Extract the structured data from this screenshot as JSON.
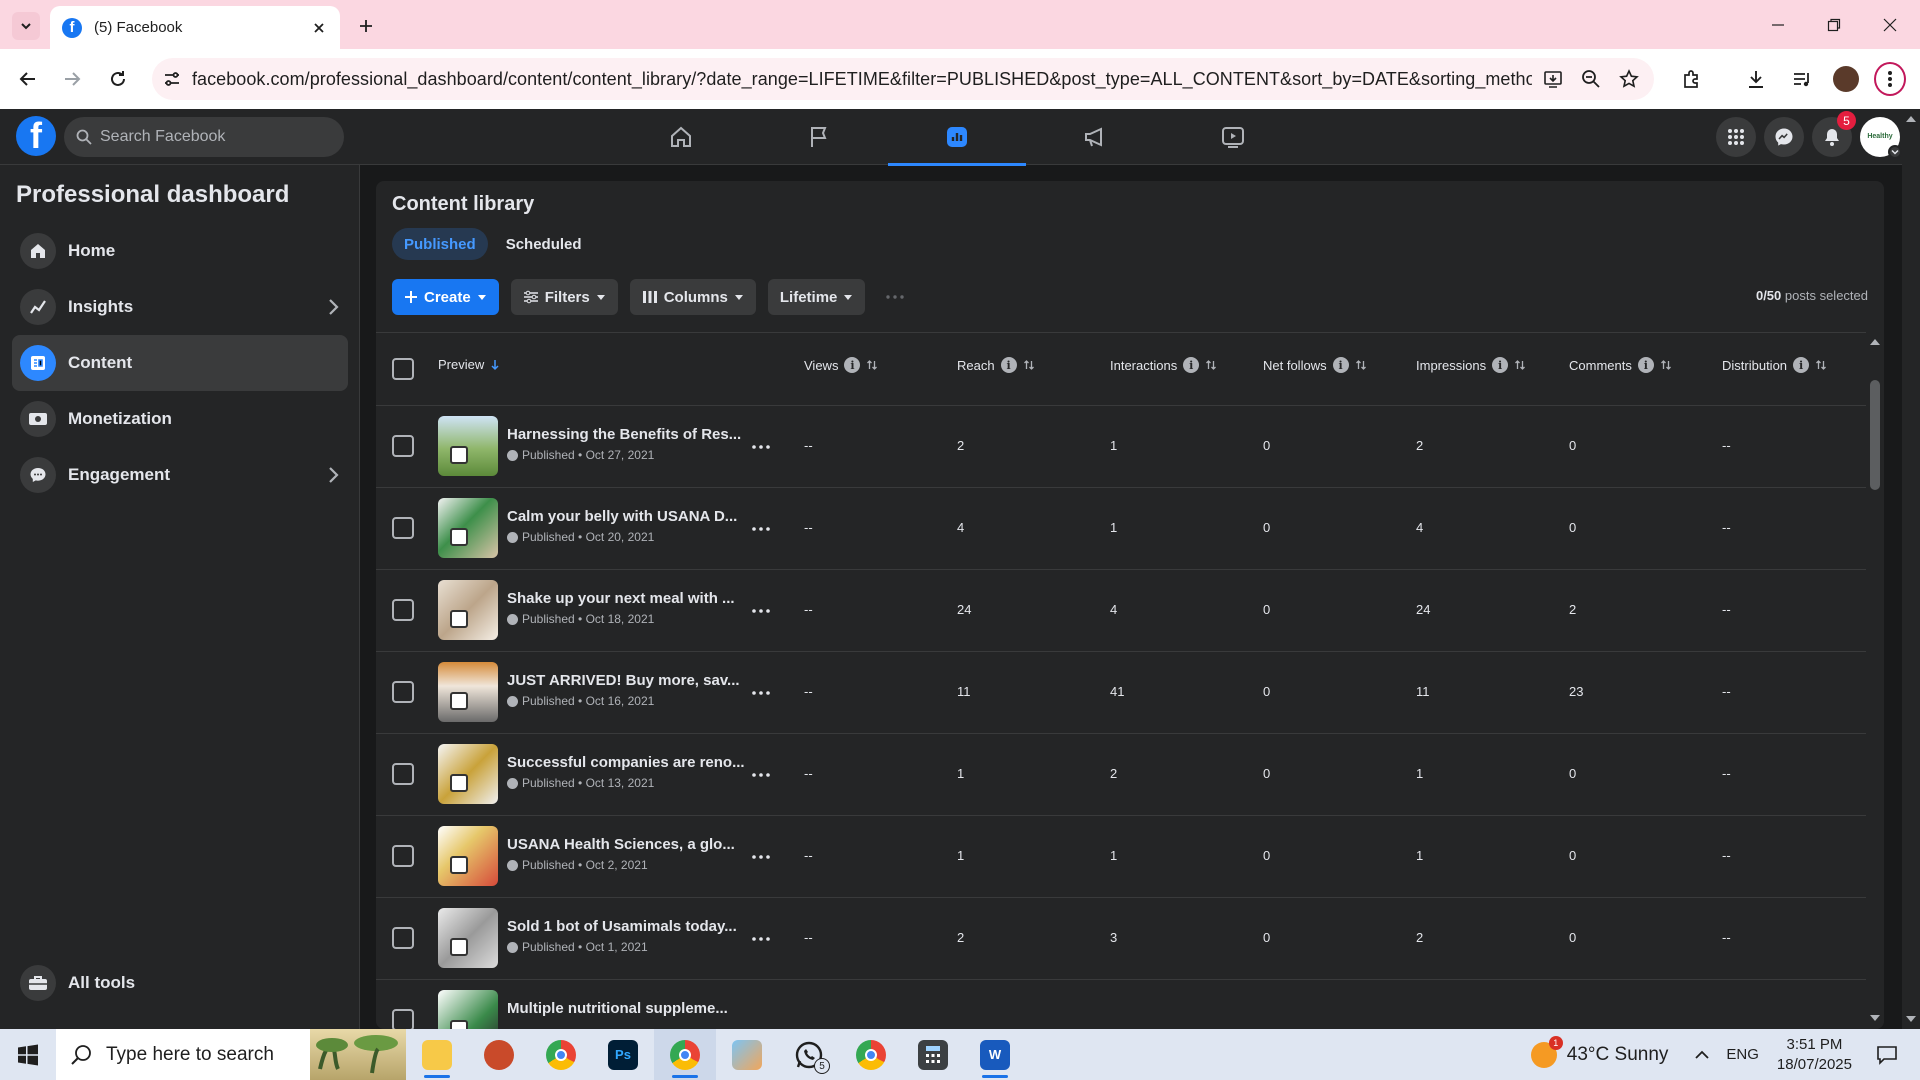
{
  "browser": {
    "tab_title": "(5) Facebook",
    "url": "facebook.com/professional_dashboard/content/content_library/?date_range=LIFETIME&filter=PUBLISHED&post_type=ALL_CONTENT&sort_by=DATE&sorting_method=..."
  },
  "fb": {
    "search_placeholder": "Search Facebook",
    "notification_count": "5",
    "profile_text": "Healthy"
  },
  "sidebar": {
    "title": "Professional dashboard",
    "items": [
      {
        "label": "Home"
      },
      {
        "label": "Insights"
      },
      {
        "label": "Content"
      },
      {
        "label": "Monetization"
      },
      {
        "label": "Engagement"
      }
    ],
    "all_tools": "All tools"
  },
  "main": {
    "title": "Content library",
    "tabs": [
      {
        "label": "Published"
      },
      {
        "label": "Scheduled"
      }
    ],
    "create_label": "Create",
    "filters_label": "Filters",
    "columns_label": "Columns",
    "lifetime_label": "Lifetime",
    "selected_count": "0/50",
    "selected_suffix": " posts selected",
    "columns": [
      "Preview",
      "Views",
      "Reach",
      "Interactions",
      "Net follows",
      "Impressions",
      "Comments",
      "Distribution"
    ],
    "rows": [
      {
        "title": "Harnessing the Benefits of Res...",
        "status": "Published • Oct 27, 2021",
        "views": "--",
        "reach": "2",
        "interactions": "1",
        "net_follows": "0",
        "impressions": "2",
        "comments": "0",
        "distribution": "--"
      },
      {
        "title": "Calm your belly with USANA D...",
        "status": "Published • Oct 20, 2021",
        "views": "--",
        "reach": "4",
        "interactions": "1",
        "net_follows": "0",
        "impressions": "4",
        "comments": "0",
        "distribution": "--"
      },
      {
        "title": "Shake up your next meal with ...",
        "status": "Published • Oct 18, 2021",
        "views": "--",
        "reach": "24",
        "interactions": "4",
        "net_follows": "0",
        "impressions": "24",
        "comments": "2",
        "distribution": "--"
      },
      {
        "title": "JUST ARRIVED! Buy more, sav...",
        "status": "Published • Oct 16, 2021",
        "views": "--",
        "reach": "11",
        "interactions": "41",
        "net_follows": "0",
        "impressions": "11",
        "comments": "23",
        "distribution": "--"
      },
      {
        "title": "Successful companies are reno...",
        "status": "Published • Oct 13, 2021",
        "views": "--",
        "reach": "1",
        "interactions": "2",
        "net_follows": "0",
        "impressions": "1",
        "comments": "0",
        "distribution": "--"
      },
      {
        "title": "USANA Health Sciences, a glo...",
        "status": "Published • Oct 2, 2021",
        "views": "--",
        "reach": "1",
        "interactions": "1",
        "net_follows": "0",
        "impressions": "1",
        "comments": "0",
        "distribution": "--"
      },
      {
        "title": "Sold 1 bot of Usamimals today...",
        "status": "Published • Oct 1, 2021",
        "views": "--",
        "reach": "2",
        "interactions": "3",
        "net_follows": "0",
        "impressions": "2",
        "comments": "0",
        "distribution": "--"
      },
      {
        "title": "Multiple nutritional suppleme...",
        "status": "",
        "views": "",
        "reach": "",
        "interactions": "",
        "net_follows": "",
        "impressions": "",
        "comments": "",
        "distribution": ""
      }
    ]
  },
  "taskbar": {
    "search_placeholder": "Type here to search",
    "weather": "43°C  Sunny",
    "weather_badge": "1",
    "whatsapp_badge": "5",
    "lang": "ENG",
    "time": "3:51 PM",
    "date": "18/07/2025"
  }
}
